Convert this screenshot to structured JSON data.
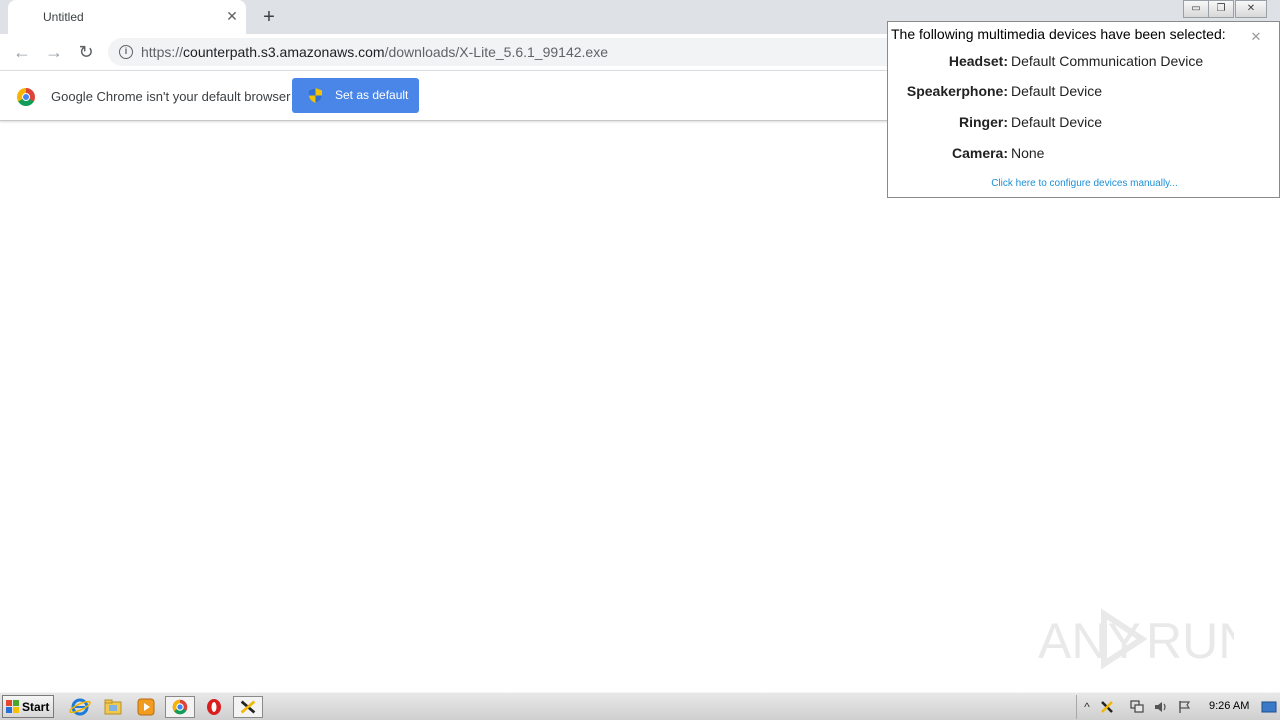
{
  "browser": {
    "tab": {
      "title": "Untitled",
      "close_glyph": "✕"
    },
    "new_tab_glyph": "+",
    "window_controls": {
      "minimize": "▭",
      "restore": "❐",
      "close": "✕"
    },
    "toolbar": {
      "back_glyph": "←",
      "forward_glyph": "→",
      "reload_glyph": "↻",
      "url_scheme": "https://",
      "url_host": "counterpath.s3.amazonaws.com",
      "url_path": "/downloads/X-Lite_5.6.1_99142.exe"
    },
    "infobar": {
      "message": "Google Chrome isn't your default browser",
      "button_label": "Set as default"
    }
  },
  "devices_popup": {
    "title": "The following multimedia devices have been selected:",
    "close_glyph": "✕",
    "devices": [
      {
        "label": "Headset:",
        "value": "Default Communication Device"
      },
      {
        "label": "Speakerphone:",
        "value": "Default Device"
      },
      {
        "label": "Ringer:",
        "value": "Default Device"
      },
      {
        "label": "Camera:",
        "value": "None"
      }
    ],
    "configure_link": "Click here to configure devices manually..."
  },
  "watermark": {
    "text": "ANY RUN"
  },
  "taskbar": {
    "start_label": "Start",
    "pinned": [
      "internet-explorer-icon",
      "file-explorer-icon",
      "media-player-icon",
      "chrome-icon",
      "opera-icon",
      "xlite-icon"
    ],
    "tray_expand_glyph": "^",
    "clock": "9:26 AM"
  },
  "colors": {
    "tab_strip": "#dee1e6",
    "set_default_button": "#4a86e8",
    "link": "#1a8fd6",
    "taskbar": "#d4d0c8"
  }
}
